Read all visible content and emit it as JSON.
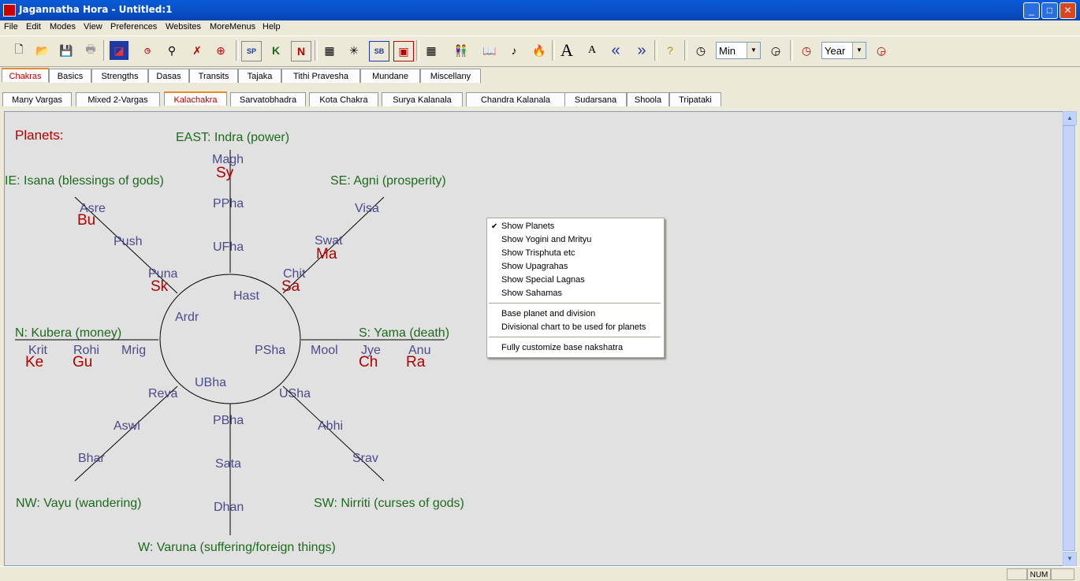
{
  "window": {
    "title": "Jagannatha Hora - Untitled:1",
    "minimize": "_",
    "maximize": "□",
    "close": "✕"
  },
  "menubar": [
    "File",
    "Edit",
    "Modes",
    "View",
    "Preferences",
    "Websites",
    "MoreMenus",
    "Help"
  ],
  "toolbar": {
    "time_unit": "Min",
    "period_unit": "Year",
    "font_large": "A",
    "font_small": "A",
    "prev": "«",
    "next": "»"
  },
  "tabs_top": [
    "Chakras",
    "Basics",
    "Strengths",
    "Dasas",
    "Transits",
    "Tajaka",
    "Tithi Pravesha",
    "Mundane",
    "Miscellany"
  ],
  "tabs_sub": [
    "Many Vargas",
    "Mixed 2-Vargas",
    "Kalachakra",
    "Sarvatobhadra",
    "Kota Chakra",
    "Surya Kalanala",
    "Chandra Kalanala",
    "Sudarsana",
    "Shoola",
    "Tripataki"
  ],
  "chakra": {
    "heading": "Planets:",
    "directions": {
      "east": "EAST: Indra (power)",
      "se": "SE: Agni (prosperity)",
      "ne": "IE: Isana (blessings of gods)",
      "north": "N: Kubera (money)",
      "south": "S: Yama (death)",
      "nw": "NW: Vayu (wandering)",
      "sw": "SW: Nirriti (curses of gods)",
      "west": "W: Varuna (suffering/foreign things)"
    },
    "nakshatras": [
      "Magh",
      "PPha",
      "UFha",
      "Hast",
      "Visa",
      "Swat",
      "Chit",
      "Asre",
      "Push",
      "Puna",
      "Ardr",
      "Krit",
      "Rohi",
      "Mrig",
      "PSha",
      "Mool",
      "Jye",
      "Anu",
      "UBha",
      "Reva",
      "Aswi",
      "Bhar",
      "PBha",
      "Sata",
      "Dhan",
      "USha",
      "Abhi",
      "Srav"
    ],
    "planets": [
      "Sy",
      "Bu",
      "Ma",
      "Sk",
      "Sa",
      "Ke",
      "Gu",
      "Ch",
      "Ra"
    ],
    "colors": {
      "direction": "#1c6b1c",
      "nakshatra": "#4a4a8c",
      "planet": "#b00000"
    }
  },
  "context_menu": {
    "items": [
      "Show Planets",
      "Show Yogini and Mrityu",
      "Show Trisphuta etc",
      "Show Upagrahas",
      "Show Special Lagnas",
      "Show Sahamas",
      "Base planet and division",
      "Divisional chart to be used for planets",
      "Fully customize base nakshatra"
    ],
    "checked": "✔"
  },
  "statusbar": {
    "num": "NUM"
  }
}
